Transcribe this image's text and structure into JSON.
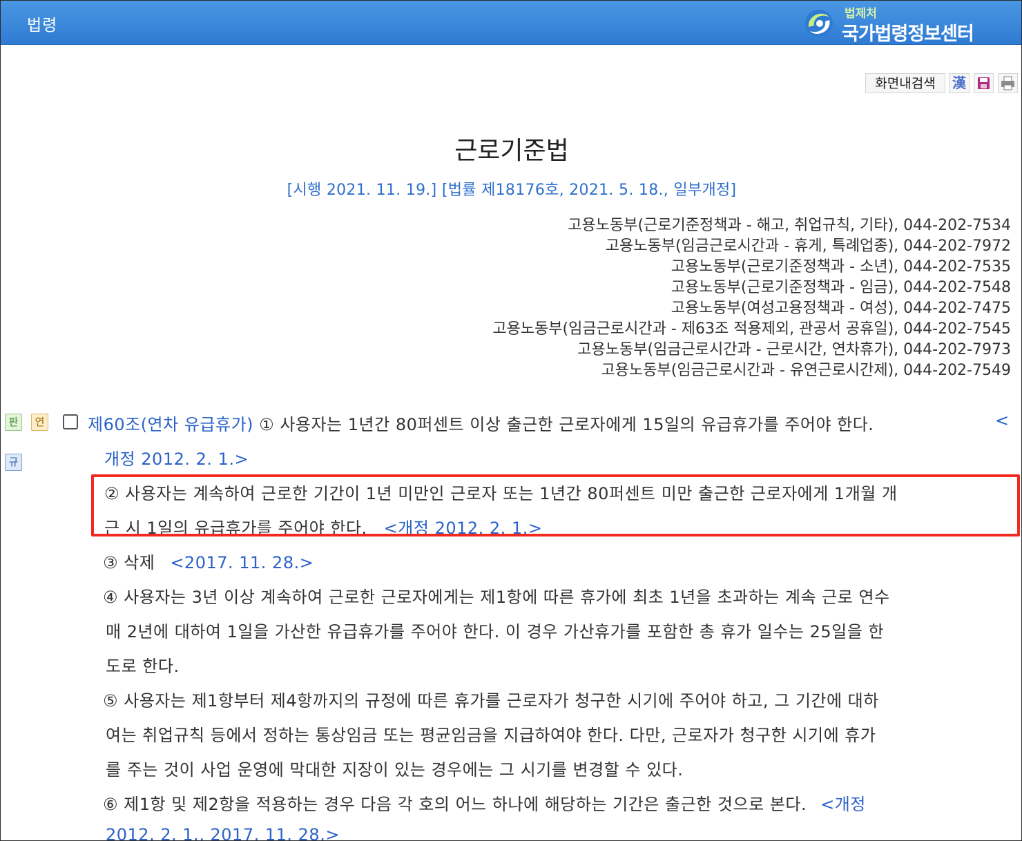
{
  "header": {
    "section_title": "법령",
    "brand_org": "법제처",
    "brand_center": "국가법령정보센터"
  },
  "toolbar": {
    "search_label": "화면내검색",
    "hanja_label": "漢",
    "save_icon": "floppy-save-icon",
    "print_icon": "printer-icon"
  },
  "law": {
    "title": "근로기준법",
    "meta": "[시행 2021. 11. 19.] [법률 제18176호, 2021. 5. 18., 일부개정]",
    "contacts": [
      "고용노동부(근로기준정책과 - 해고, 취업규칙, 기타), 044-202-7534",
      "고용노동부(임금근로시간과 - 휴게, 특례업종), 044-202-7972",
      "고용노동부(근로기준정책과 - 소년), 044-202-7535",
      "고용노동부(근로기준정책과 - 임금), 044-202-7548",
      "고용노동부(여성고용정책과 - 여성), 044-202-7475",
      "고용노동부(임금근로시간과 - 제63조 적용제외, 관공서 공휴일), 044-202-7545",
      "고용노동부(임금근로시간과 - 근로시간, 연차휴가), 044-202-7973",
      "고용노동부(임금근로시간과 - 유연근로시간제), 044-202-7549"
    ]
  },
  "badges": {
    "pan": "판",
    "yeon": "연",
    "gyu": "규"
  },
  "article": {
    "heading": "제60조(연차 유급휴가)",
    "p1_text": " ① 사용자는 1년간 80퍼센트 이상 출근한 근로자에게 15일의 유급휴가를 주어야 한다.",
    "p1_amend_open": "<",
    "p1_amend_rest": "개정 2012. 2. 1.>",
    "p2_line1": "② 사용자는 계속하여 근로한 기간이 1년 미만인 근로자 또는 1년간 80퍼센트 미만 출근한 근로자에게 1개월 개",
    "p2_line2": "근 시 1일의 유급휴가를 주어야 한다.",
    "p2_amend": "<개정 2012. 2. 1.>",
    "p3_text": "③ 삭제",
    "p3_amend": "<2017. 11. 28.>",
    "p4_line1": "④ 사용자는 3년 이상 계속하여 근로한 근로자에게는 제1항에 따른 휴가에 최초 1년을 초과하는 계속 근로 연수",
    "p4_line2": "매 2년에 대하여 1일을 가산한 유급휴가를 주어야 한다. 이 경우 가산휴가를 포함한 총 휴가 일수는 25일을 한",
    "p4_line3": "도로 한다.",
    "p5_line1": "⑤ 사용자는 제1항부터 제4항까지의 규정에 따른 휴가를 근로자가 청구한 시기에 주어야 하고, 그 기간에 대하",
    "p5_line2": "여는 취업규칙 등에서 정하는 통상임금 또는 평균임금을 지급하여야 한다. 다만, 근로자가 청구한 시기에 휴가",
    "p5_line3": "를 주는 것이 사업 운영에 막대한 지장이 있는 경우에는 그 시기를 변경할 수 있다.",
    "p6_line1": "⑥ 제1항 및 제2항을 적용하는 경우 다음 각 호의 어느 하나에 해당하는 기간은 출근한 것으로 본다.",
    "p6_amend": "<개정",
    "p6_line2": "2012. 2. 1., 2017. 11. 28.>"
  },
  "colors": {
    "header_bg": "#3a88dc",
    "link_blue": "#2b62c9",
    "highlight_border": "#f02a1e"
  }
}
